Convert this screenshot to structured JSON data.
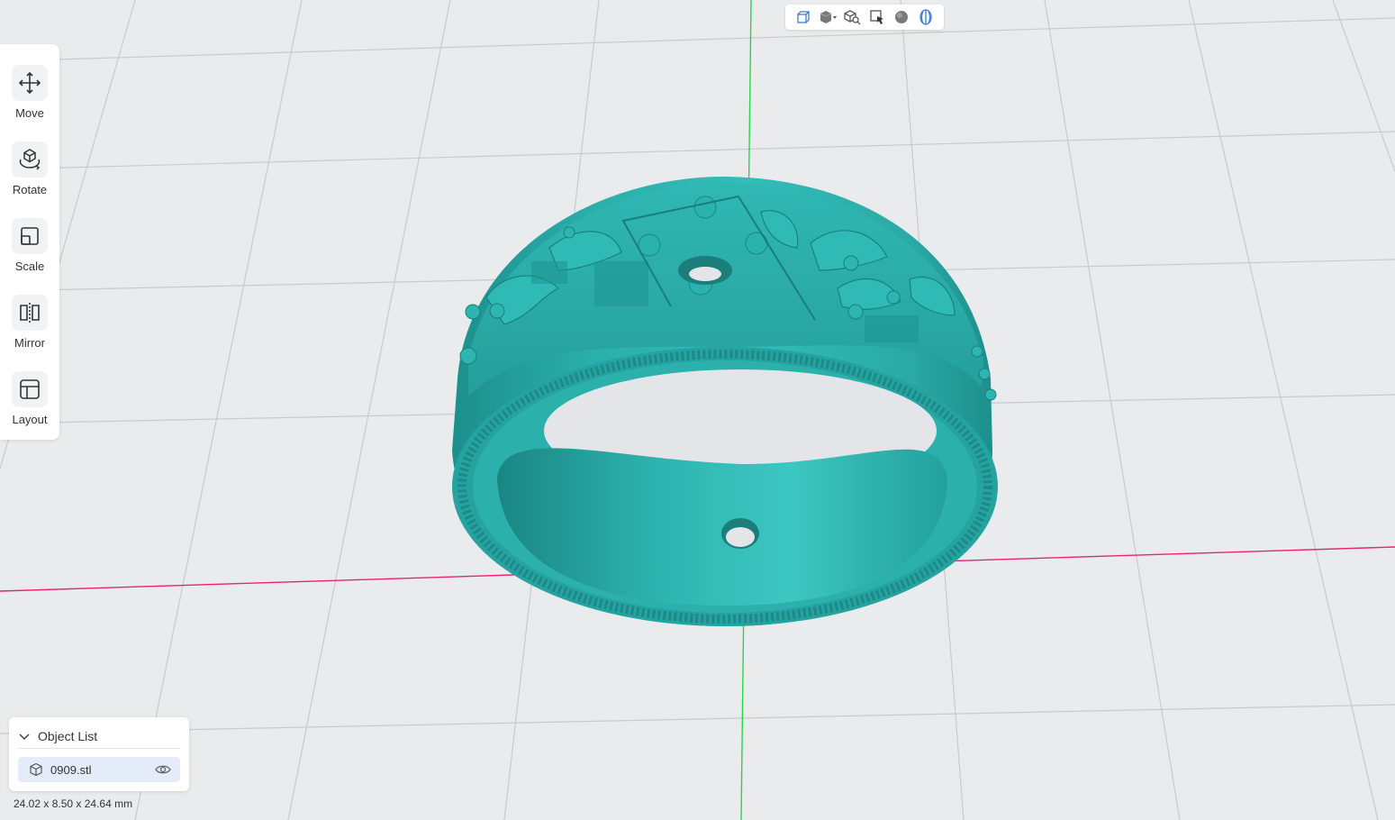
{
  "view_toolbar": {
    "buttons": [
      {
        "icon": "view-cube-icon"
      },
      {
        "icon": "solid-cube-dropdown-icon"
      },
      {
        "icon": "zoom-fit-cube-icon"
      },
      {
        "icon": "select-cursor-icon"
      },
      {
        "icon": "material-sphere-icon"
      },
      {
        "icon": "wireframe-shell-icon"
      }
    ]
  },
  "tools": [
    {
      "label": "Move",
      "icon": "move-arrows-icon"
    },
    {
      "label": "Rotate",
      "icon": "rotate-cube-icon"
    },
    {
      "label": "Scale",
      "icon": "scale-box-icon"
    },
    {
      "label": "Mirror",
      "icon": "mirror-icon"
    },
    {
      "label": "Layout",
      "icon": "layout-icon"
    }
  ],
  "object_list": {
    "title": "Object List",
    "items": [
      {
        "name": "0909.stl",
        "visible": true
      }
    ]
  },
  "dimensions": "24.02 x 8.50 x 24.64 mm",
  "colors": {
    "model": "#2fb7b3",
    "model_dark": "#1c8e8b",
    "grid": "#c9cacd",
    "axis_x": "#e8256d",
    "axis_y": "#2bd24d",
    "background": "#eaebed",
    "accent": "#3b7bd6"
  }
}
